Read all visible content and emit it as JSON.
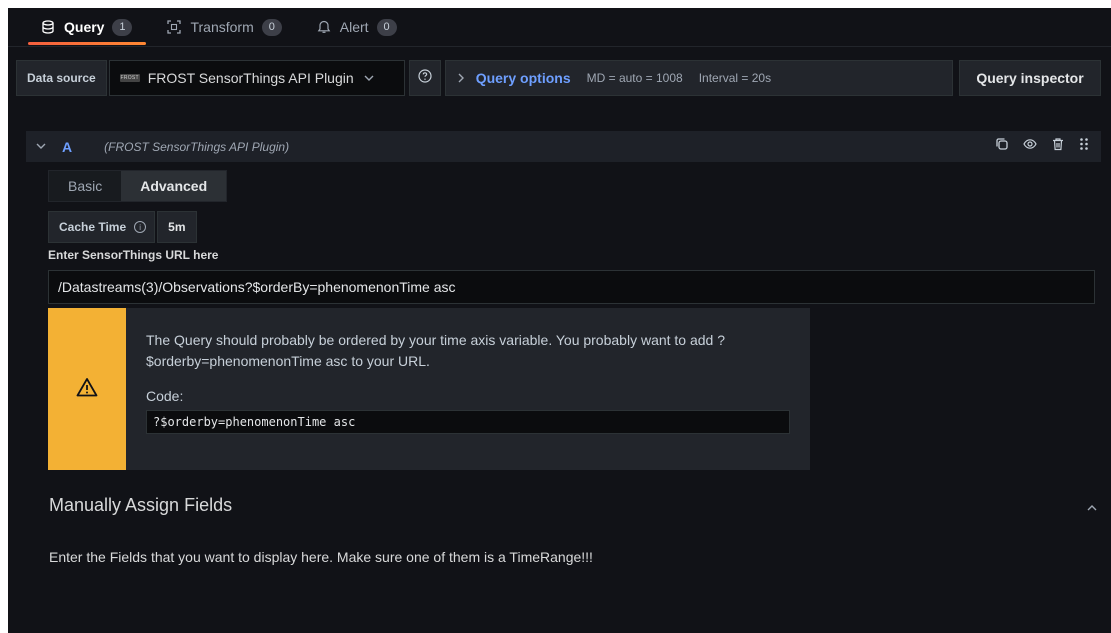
{
  "tabs": [
    {
      "label": "Query",
      "count": "1",
      "icon": "database-icon"
    },
    {
      "label": "Transform",
      "count": "0",
      "icon": "transform-icon"
    },
    {
      "label": "Alert",
      "count": "0",
      "icon": "bell-icon"
    }
  ],
  "toolbar": {
    "datasource_label": "Data source",
    "datasource_value": "FROST SensorThings API Plugin",
    "datasource_logo_text": "FROST",
    "query_options_label": "Query options",
    "md_text": "MD = auto = 1008",
    "interval_text": "Interval = 20s",
    "inspector_label": "Query inspector"
  },
  "query": {
    "ref_id": "A",
    "datasource_name": "(FROST SensorThings API Plugin)",
    "mode_options": [
      "Basic",
      "Advanced"
    ],
    "selected_mode": "Advanced",
    "cache_label": "Cache Time",
    "cache_value": "5m",
    "url_label": "Enter SensorThings URL here",
    "url_value": "/Datastreams(3)/Observations?$orderBy=phenomenonTime asc"
  },
  "alert": {
    "message": "The Query should probably be ordered by your time axis variable. You probably want to add ?$orderby=phenomenonTime asc to your URL.",
    "code_label": "Code:",
    "code_value": "?$orderby=phenomenonTime asc",
    "color": "#f3b134"
  },
  "fields": {
    "title": "Manually Assign Fields",
    "description": "Enter the Fields that you want to display here. Make sure one of them is a TimeRange!!!"
  },
  "colors": {
    "accent_blue": "#6e9fff",
    "tab_underline": "#ff8833",
    "background": "#111217"
  }
}
